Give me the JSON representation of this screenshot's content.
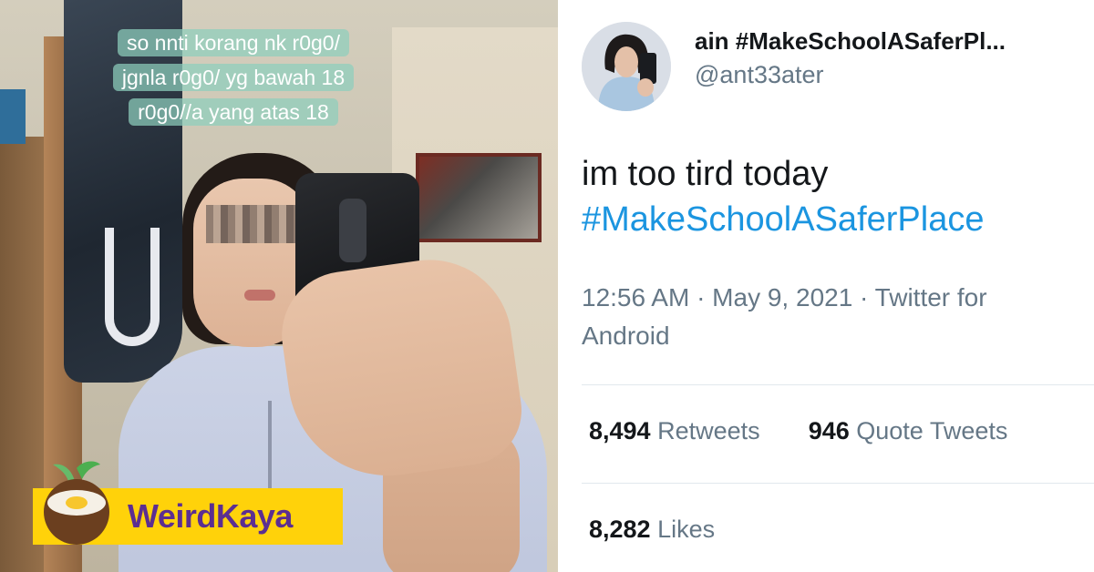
{
  "video": {
    "caption_lines": [
      "so nnti korang nk r0g0/",
      "jgnla r0g0/ yg bawah 18",
      "r0g0//a yang atas 18"
    ]
  },
  "logo": {
    "text": "WeirdKaya",
    "colors": {
      "background": "#ffd20a",
      "text": "#5c2e91"
    }
  },
  "tweet": {
    "display_name": "ain #MakeSchoolASaferPl...",
    "handle": "@ant33ater",
    "text": "im too tird today",
    "hashtag": "#MakeSchoolASaferPlace",
    "meta": "12:56 AM · May 9, 2021 · Twitter for Android",
    "retweets_count": "8,494",
    "retweets_label": "Retweets",
    "quote_count": "946",
    "quote_label": "Quote Tweets",
    "likes_count": "8,282",
    "likes_label": "Likes",
    "colors": {
      "hashtag": "#1b95e0",
      "secondary": "#657786",
      "primary": "#14171a"
    }
  }
}
